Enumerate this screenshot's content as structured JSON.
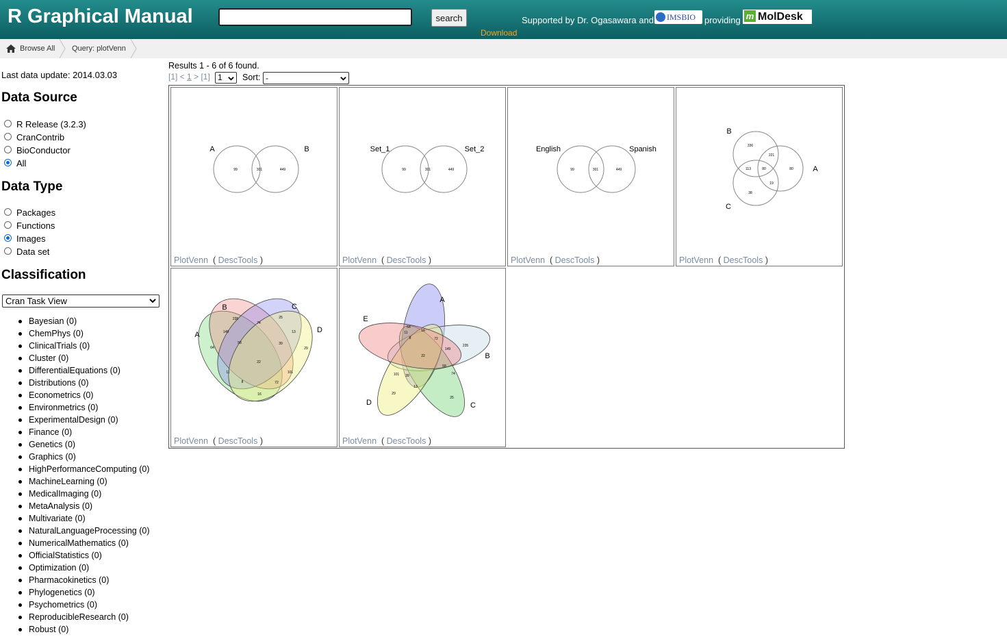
{
  "header": {
    "title": "R Graphical Manual",
    "search_value": "",
    "search_button": "search",
    "support_text": "Supported by Dr. Ogasawara and",
    "imsbio_logo": "IMSBIO",
    "providing_text": "providing",
    "moldesk_logo": "MolDesk",
    "download": "Download",
    "background_color": "#1a7a7a",
    "download_color": "#f7a81c"
  },
  "breadcrumb": [
    {
      "label": "Browse All",
      "icon": "home-icon"
    },
    {
      "label": "Query: plotVenn"
    }
  ],
  "sidebar": {
    "last_update": "Last data update: 2014.03.03",
    "data_source": {
      "title": "Data Source",
      "options": [
        {
          "label": "R Release (3.2.3)",
          "checked": false
        },
        {
          "label": "CranContrib",
          "checked": false
        },
        {
          "label": "BioConductor",
          "checked": false
        },
        {
          "label": "All",
          "checked": true
        }
      ]
    },
    "data_type": {
      "title": "Data Type",
      "options": [
        {
          "label": "Packages",
          "checked": false
        },
        {
          "label": "Functions",
          "checked": false
        },
        {
          "label": "Images",
          "checked": true
        },
        {
          "label": "Data set",
          "checked": false
        }
      ]
    },
    "classification": {
      "title": "Classification",
      "selected": "Cran Task View",
      "items": [
        "Bayesian (0)",
        "ChemPhys (0)",
        "ClinicalTrials (0)",
        "Cluster (0)",
        "DifferentialEquations (0)",
        "Distributions (0)",
        "Econometrics (0)",
        "Environmetrics (0)",
        "ExperimentalDesign (0)",
        "Finance (0)",
        "Genetics (0)",
        "Graphics (0)",
        "HighPerformanceComputing (0)",
        "MachineLearning (0)",
        "MedicalImaging (0)",
        "MetaAnalysis (0)",
        "Multivariate (0)",
        "NaturalLanguageProcessing (0)",
        "NumericalMathematics (0)",
        "OfficialStatistics (0)",
        "Optimization (0)",
        "Pharmacokinetics (0)",
        "Phylogenetics (0)",
        "Psychometrics (0)",
        "ReproducibleResearch (0)",
        "Robust (0)"
      ]
    }
  },
  "results": {
    "summary": "Results 1 - 6 of 6 found.",
    "pager": {
      "first": "[1]",
      "prev": "<",
      "current": "1",
      "next": ">",
      "last": "[1]",
      "page_select": "1"
    },
    "sort_label": "Sort:",
    "sort_value": "-",
    "items": [
      {
        "function": "PlotVenn",
        "package": "DescTools"
      },
      {
        "function": "PlotVenn",
        "package": "DescTools"
      },
      {
        "function": "PlotVenn",
        "package": "DescTools"
      },
      {
        "function": "PlotVenn",
        "package": "DescTools"
      },
      {
        "function": "PlotVenn",
        "package": "DescTools"
      },
      {
        "function": "PlotVenn",
        "package": "DescTools"
      }
    ],
    "thumbs": {
      "venn2_ab": {
        "labels": [
          "A",
          "B"
        ],
        "counts": [
          "99",
          "301",
          "449"
        ]
      },
      "venn2_set": {
        "labels": [
          "Set_1",
          "Set_2"
        ],
        "counts": [
          "99",
          "301",
          "449"
        ]
      },
      "venn2_lang": {
        "labels": [
          "English",
          "Spanish"
        ],
        "counts": [
          "99",
          "301",
          "449"
        ]
      },
      "venn3": {
        "labels": [
          "B",
          "A",
          "C"
        ],
        "counts": [
          "336",
          "221",
          "113",
          "80",
          "80",
          "19",
          "38"
        ]
      },
      "venn4": {
        "labels": [
          "A",
          "B",
          "C",
          "D"
        ],
        "counts": [
          "235",
          "74",
          "25",
          "149",
          "58",
          "39",
          "13",
          "64",
          "29",
          "22",
          "11",
          "101",
          "8",
          "72",
          "16"
        ]
      },
      "venn5": {
        "labels": [
          "A",
          "B",
          "C",
          "D",
          "E"
        ],
        "counts": [
          "64",
          "16",
          "11",
          "72",
          "8",
          "235",
          "149",
          "22",
          "58",
          "74",
          "101",
          "39",
          "13",
          "29",
          "25"
        ]
      }
    }
  }
}
